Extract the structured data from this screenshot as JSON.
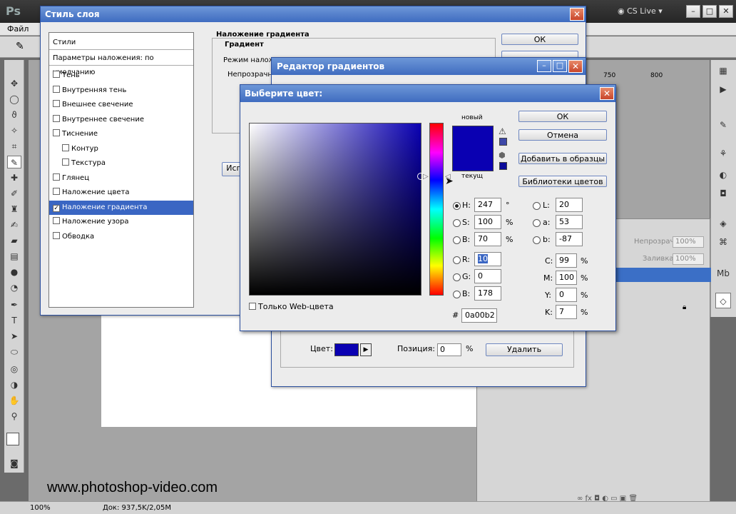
{
  "ps": {
    "logo": "Ps",
    "cs_live": "CS Live",
    "menu_file": "Файл",
    "ruler_750": "750",
    "ruler_800": "800",
    "layers_opacity_label": "Непрозрачность:",
    "layers_opacity_value": "100%",
    "layers_fill_label": "Заливка:",
    "layers_fill_value": "100%",
    "status_zoom": "100%",
    "status_doc": "Док: 937,5K/2,05M",
    "watermark": "www.photoshop-video.com"
  },
  "style_dialog": {
    "title": "Стиль слоя",
    "list_header": "Стили",
    "blend_default": "Параметры наложения: по умолчанию",
    "items": [
      {
        "label": "Тень",
        "checked": false,
        "indent": false
      },
      {
        "label": "Внутренняя тень",
        "checked": false,
        "indent": false
      },
      {
        "label": "Внешнее свечение",
        "checked": false,
        "indent": false
      },
      {
        "label": "Внутреннее свечение",
        "checked": false,
        "indent": false
      },
      {
        "label": "Тиснение",
        "checked": false,
        "indent": false
      },
      {
        "label": "Контур",
        "checked": false,
        "indent": true
      },
      {
        "label": "Текстура",
        "checked": false,
        "indent": true
      },
      {
        "label": "Глянец",
        "checked": false,
        "indent": false
      },
      {
        "label": "Наложение цвета",
        "checked": false,
        "indent": false
      },
      {
        "label": "Наложение градиента",
        "checked": true,
        "indent": false,
        "selected": true
      },
      {
        "label": "Наложение узора",
        "checked": false,
        "indent": false
      },
      {
        "label": "Обводка",
        "checked": false,
        "indent": false
      }
    ],
    "section_title": "Наложение градиента",
    "section_sub": "Градиент",
    "blend_label": "Режим наложе",
    "opacity_label": "Непрозрачно",
    "ok": "ОК",
    "isp": "Исп"
  },
  "gradient_editor": {
    "title": "Редактор градиентов",
    "color_label": "Цвет:",
    "position_label": "Позиция:",
    "position_value": "0",
    "position_unit": "%",
    "delete": "Удалить"
  },
  "picker": {
    "title": "Выберите цвет:",
    "label_new": "новый",
    "label_current": "текущ",
    "ok": "ОК",
    "cancel": "Отмена",
    "add_swatch": "Добавить в образцы",
    "libraries": "Библиотеки цветов",
    "web_only": "Только Web-цвета",
    "fields": {
      "H": {
        "label": "H:",
        "value": "247",
        "unit": "°"
      },
      "S": {
        "label": "S:",
        "value": "100",
        "unit": "%"
      },
      "B": {
        "label": "B:",
        "value": "70",
        "unit": "%"
      },
      "R": {
        "label": "R:",
        "value": "10"
      },
      "G": {
        "label": "G:",
        "value": "0"
      },
      "Bl": {
        "label": "B:",
        "value": "178"
      },
      "L": {
        "label": "L:",
        "value": "20"
      },
      "a": {
        "label": "a:",
        "value": "53"
      },
      "b": {
        "label": "b:",
        "value": "-87"
      },
      "C": {
        "label": "C:",
        "value": "99",
        "unit": "%"
      },
      "M": {
        "label": "M:",
        "value": "100",
        "unit": "%"
      },
      "Y": {
        "label": "Y:",
        "value": "0",
        "unit": "%"
      },
      "K": {
        "label": "K:",
        "value": "7",
        "unit": "%"
      }
    },
    "hex_label": "#",
    "hex_value": "0a00b2",
    "new_color": "#0a00b2"
  },
  "icons": {
    "warn": "warning-icon",
    "cube": "web-cube-icon"
  }
}
